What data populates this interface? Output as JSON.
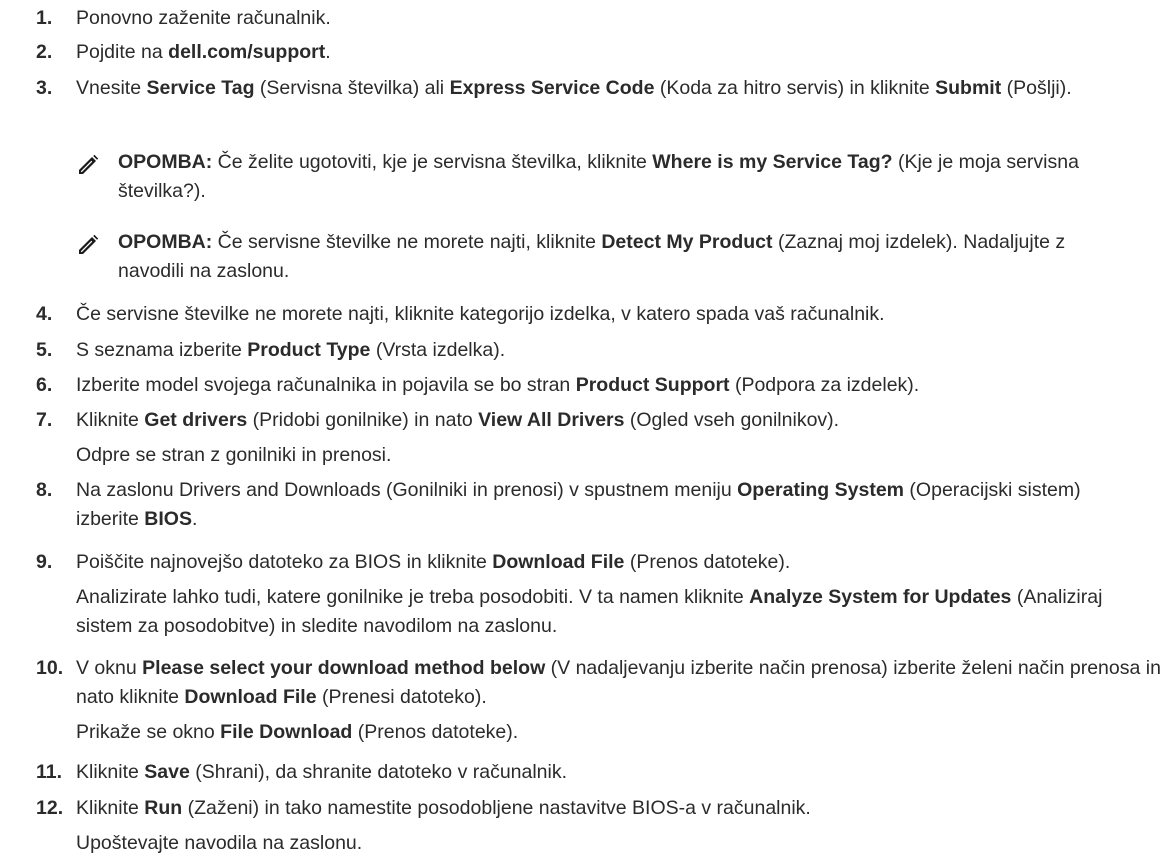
{
  "steps": [
    {
      "num": "1.",
      "segments": [
        {
          "t": "Ponovno zaženite računalnik."
        }
      ]
    },
    {
      "num": "2.",
      "segments": [
        {
          "t": "Pojdite na "
        },
        {
          "t": "dell.com/support",
          "b": true
        },
        {
          "t": "."
        }
      ]
    },
    {
      "num": "3.",
      "segments": [
        {
          "t": "Vnesite "
        },
        {
          "t": "Service Tag",
          "b": true
        },
        {
          "t": " (Servisna številka) ali "
        },
        {
          "t": "Express Service Code",
          "b": true
        },
        {
          "t": " (Koda za hitro servis) in kliknite "
        },
        {
          "t": "Submit",
          "b": true
        },
        {
          "t": " (Pošlji)."
        }
      ]
    },
    {
      "num": "4.",
      "segments": [
        {
          "t": "Če servisne številke ne morete najti, kliknite kategorijo izdelka, v katero spada vaš računalnik."
        }
      ]
    },
    {
      "num": "5.",
      "segments": [
        {
          "t": "S seznama izberite "
        },
        {
          "t": "Product Type",
          "b": true
        },
        {
          "t": " (Vrsta izdelka)."
        }
      ]
    },
    {
      "num": "6.",
      "segments": [
        {
          "t": "Izberite model svojega računalnika in pojavila se bo stran "
        },
        {
          "t": "Product Support",
          "b": true
        },
        {
          "t": " (Podpora za izdelek)."
        }
      ]
    },
    {
      "num": "7.",
      "segments": [
        {
          "t": "Kliknite "
        },
        {
          "t": "Get drivers",
          "b": true
        },
        {
          "t": " (Pridobi gonilnike) in nato "
        },
        {
          "t": "View All Drivers",
          "b": true
        },
        {
          "t": " (Ogled vseh gonilnikov)."
        }
      ],
      "sub": [
        {
          "t": "Odpre se stran z gonilniki in prenosi."
        }
      ]
    },
    {
      "num": "8.",
      "segments": [
        {
          "t": "Na zaslonu Drivers and Downloads (Gonilniki in prenosi) v spustnem meniju "
        },
        {
          "t": "Operating System",
          "b": true
        },
        {
          "t": " (Operacijski sistem) izberite "
        },
        {
          "t": "BIOS",
          "b": true
        },
        {
          "t": "."
        }
      ]
    },
    {
      "num": "9.",
      "segments": [
        {
          "t": "Poiščite najnovejšo datoteko za BIOS in kliknite "
        },
        {
          "t": "Download File",
          "b": true
        },
        {
          "t": " (Prenos datoteke)."
        }
      ],
      "sub": [
        {
          "t": "Analizirate lahko tudi, katere gonilnike je treba posodobiti. V ta namen kliknite "
        },
        {
          "t": "Analyze System for Updates",
          "b": true
        },
        {
          "t": " (Analiziraj sistem za posodobitve) in sledite navodilom na zaslonu."
        }
      ]
    },
    {
      "num": "10.",
      "segments": [
        {
          "t": "V oknu "
        },
        {
          "t": "Please select your download method below",
          "b": true
        },
        {
          "t": " (V nadaljevanju izberite način prenosa) izberite želeni način prenosa in nato kliknite "
        },
        {
          "t": "Download File",
          "b": true
        },
        {
          "t": " (Prenesi datoteko)."
        }
      ],
      "sub": [
        {
          "t": "Prikaže se okno "
        },
        {
          "t": "File Download",
          "b": true
        },
        {
          "t": " (Prenos datoteke)."
        }
      ]
    },
    {
      "num": "11.",
      "segments": [
        {
          "t": "Kliknite "
        },
        {
          "t": "Save",
          "b": true
        },
        {
          "t": " (Shrani), da shranite datoteko v računalnik."
        }
      ]
    },
    {
      "num": "12.",
      "segments": [
        {
          "t": "Kliknite "
        },
        {
          "t": "Run",
          "b": true
        },
        {
          "t": " (Zaženi) in tako namestite posodobljene nastavitve BIOS-a v računalnik."
        }
      ],
      "sub": [
        {
          "t": "Upoštevajte navodila na zaslonu."
        }
      ]
    }
  ],
  "notes": [
    {
      "segments": [
        {
          "t": "OPOMBA:",
          "b": true
        },
        {
          "t": " Če želite ugotoviti, kje je servisna številka, kliknite "
        },
        {
          "t": "Where is my Service Tag?",
          "b": true
        },
        {
          "t": " (Kje je moja servisna številka?)."
        }
      ]
    },
    {
      "segments": [
        {
          "t": "OPOMBA:",
          "b": true
        },
        {
          "t": " Če servisne številke ne morete najti, kliknite "
        },
        {
          "t": "Detect My Product",
          "b": true
        },
        {
          "t": " (Zaznaj moj izdelek). Nadaljujte z navodili na zaslonu."
        }
      ]
    }
  ],
  "note_icon": "pencil-note-icon"
}
